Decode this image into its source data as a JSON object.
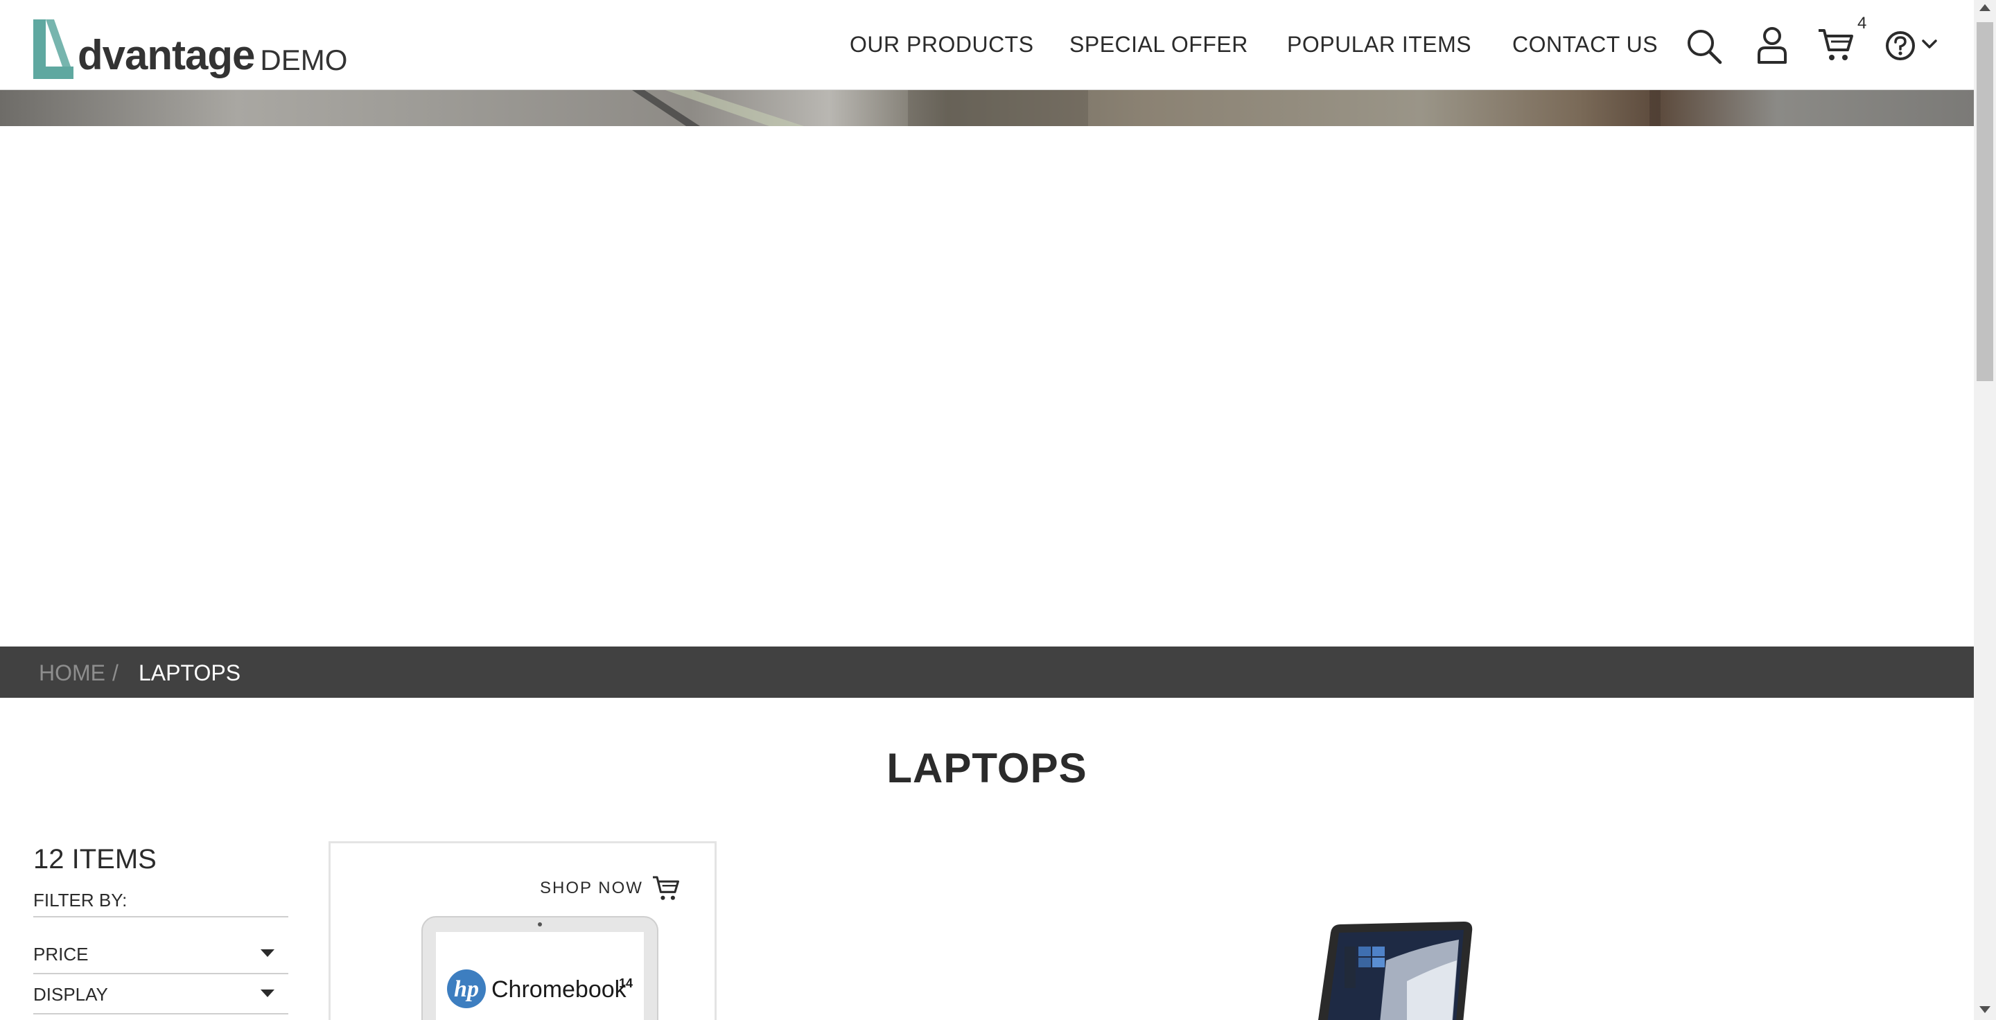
{
  "header": {
    "logo": {
      "main": "dvantage",
      "suffix": "DEMO"
    },
    "nav": [
      {
        "label": "OUR PRODUCTS"
      },
      {
        "label": "SPECIAL OFFER"
      },
      {
        "label": "POPULAR ITEMS"
      },
      {
        "label": "CONTACT US"
      }
    ],
    "icons": {
      "search": "search-icon",
      "user": "user-icon",
      "cart": "cart-icon",
      "help": "help-icon",
      "dropdown": "chevron-down-icon"
    },
    "cart_count": "4"
  },
  "breadcrumb": {
    "home": "HOME",
    "separator": "/",
    "current": "LAPTOPS"
  },
  "page": {
    "title": "LAPTOPS"
  },
  "sidebar": {
    "items_count": "12 ITEMS",
    "filter_by": "FILTER BY:",
    "filters": [
      {
        "label": "PRICE"
      },
      {
        "label": "DISPLAY"
      }
    ]
  },
  "products": [
    {
      "shop_now": "SHOP NOW",
      "image_text": "Chromebook",
      "image_sup": "14"
    }
  ],
  "colors": {
    "brand_teal": "#5fa8a0",
    "breadcrumb_bg": "#414141",
    "text": "#2b2b2b"
  }
}
